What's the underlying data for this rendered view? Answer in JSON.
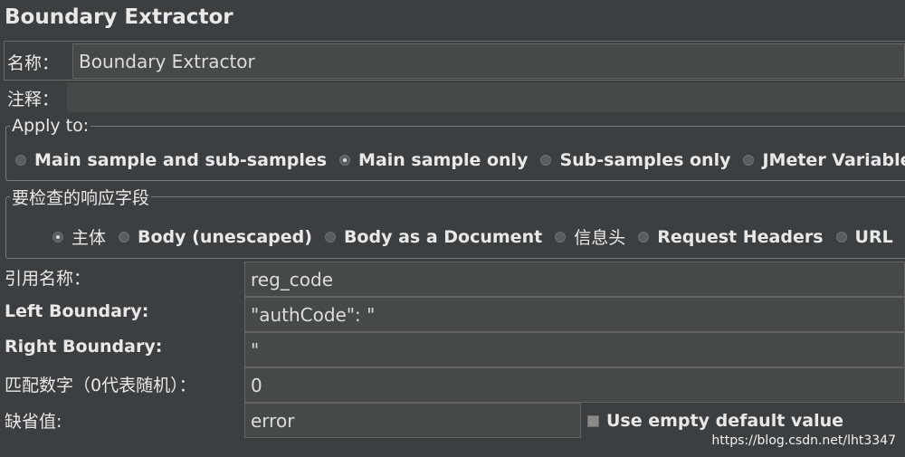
{
  "page": {
    "title": "Boundary Extractor"
  },
  "name_row": {
    "label": "名称：",
    "value": "Boundary Extractor"
  },
  "comment_row": {
    "label": "注释：",
    "value": ""
  },
  "apply_to": {
    "legend": "Apply to:",
    "options": [
      {
        "label": "Main sample and sub-samples",
        "selected": false
      },
      {
        "label": "Main sample only",
        "selected": true
      },
      {
        "label": "Sub-samples only",
        "selected": false
      },
      {
        "label": "JMeter Variable Na",
        "selected": false
      }
    ]
  },
  "response_field": {
    "legend": "要检查的响应字段",
    "options": [
      {
        "label": "主体",
        "selected": true
      },
      {
        "label": "Body (unescaped)",
        "selected": false
      },
      {
        "label": "Body as a Document",
        "selected": false
      },
      {
        "label": "信息头",
        "selected": false
      },
      {
        "label": "Request Headers",
        "selected": false
      },
      {
        "label": "URL",
        "selected": false
      }
    ]
  },
  "form": {
    "ref_name": {
      "label": "引用名称：",
      "value": "reg_code"
    },
    "left_boundary": {
      "label": "Left Boundary:",
      "value": "\"authCode\": \""
    },
    "right_boundary": {
      "label": "Right Boundary:",
      "value": "\""
    },
    "match_no": {
      "label": "匹配数字（0代表随机）：",
      "value": "0"
    },
    "default_value": {
      "label": "缺省值:",
      "value": "error"
    },
    "use_empty_default": {
      "label": "Use empty default value",
      "checked": false
    }
  },
  "watermark": "https://blog.csdn.net/lht3347"
}
